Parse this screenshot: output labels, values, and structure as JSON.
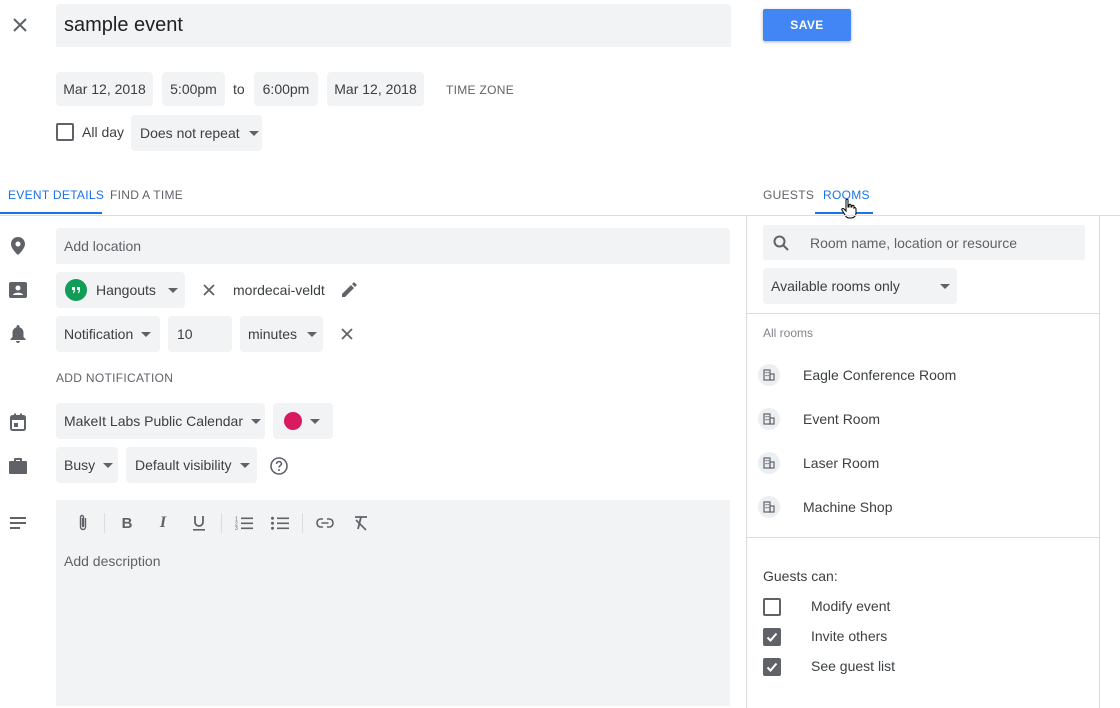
{
  "header": {
    "title": "sample event",
    "save_label": "SAVE"
  },
  "datetime": {
    "start_date": "Mar 12, 2018",
    "start_time": "5:00pm",
    "to_label": "to",
    "end_time": "6:00pm",
    "end_date": "Mar 12, 2018",
    "timezone_label": "TIME ZONE",
    "allday_label": "All day",
    "repeat_value": "Does not repeat"
  },
  "tabs": {
    "left": [
      "EVENT DETAILS",
      "FIND A TIME"
    ],
    "right": [
      "GUESTS",
      "ROOMS"
    ],
    "active_left": "EVENT DETAILS",
    "active_right": "ROOMS"
  },
  "details": {
    "location_placeholder": "Add location",
    "conference_value": "Hangouts",
    "conference_id": "mordecai-veldt",
    "notification_type": "Notification",
    "notification_amount": "10",
    "notification_unit": "minutes",
    "add_notification_label": "ADD NOTIFICATION",
    "calendar_value": "MakeIt Labs Public Calendar",
    "event_color": "#d81b60",
    "busy_value": "Busy",
    "visibility_value": "Default visibility",
    "description_placeholder": "Add description"
  },
  "rooms": {
    "search_placeholder": "Room name, location or resource",
    "filter_value": "Available rooms only",
    "section_label": "All rooms",
    "items": [
      "Eagle Conference Room",
      "Event Room",
      "Laser Room",
      "Machine Shop"
    ]
  },
  "guests_can": {
    "label": "Guests can:",
    "options": [
      {
        "label": "Modify event",
        "checked": false
      },
      {
        "label": "Invite others",
        "checked": true
      },
      {
        "label": "See guest list",
        "checked": true
      }
    ]
  },
  "colors": {
    "accent": "#1a73e8",
    "save_button": "#4285f4",
    "field_bg": "#f1f3f4"
  }
}
